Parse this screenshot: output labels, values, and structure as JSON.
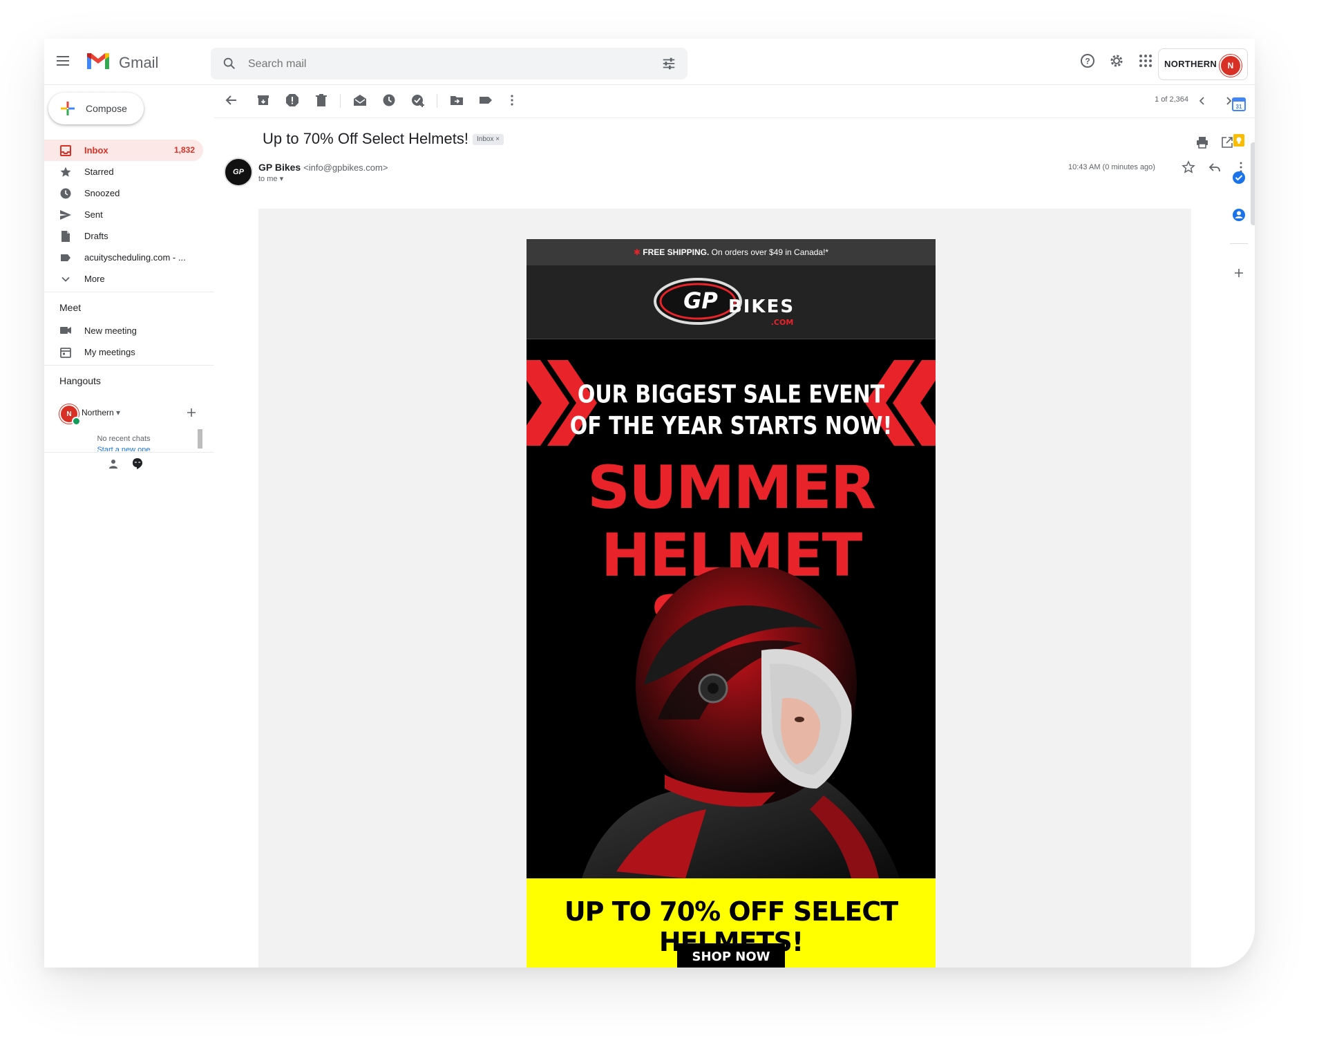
{
  "app": {
    "name": "Gmail"
  },
  "search": {
    "placeholder": "Search mail"
  },
  "account": {
    "brand": "NORTHERN",
    "avatar_letter": "N"
  },
  "compose": {
    "label": "Compose"
  },
  "nav": [
    {
      "label": "Inbox",
      "count": "1,832",
      "icon": "inbox-icon"
    },
    {
      "label": "Starred",
      "count": "",
      "icon": "star-icon"
    },
    {
      "label": "Snoozed",
      "count": "",
      "icon": "clock-icon"
    },
    {
      "label": "Sent",
      "count": "",
      "icon": "send-icon"
    },
    {
      "label": "Drafts",
      "count": "",
      "icon": "draft-icon"
    },
    {
      "label": "acuityscheduling.com - ...",
      "count": "",
      "icon": "label-icon"
    },
    {
      "label": "More",
      "count": "",
      "icon": "chevron-down-icon"
    }
  ],
  "meet": {
    "title": "Meet",
    "new_meeting": "New meeting",
    "my_meetings": "My meetings"
  },
  "hangouts": {
    "title": "Hangouts",
    "user": "Northern",
    "no_chats": "No recent chats",
    "start_chat": "Start a new one"
  },
  "toolbar": {
    "pager": "1 of 2,364"
  },
  "message": {
    "subject": "Up to 70% Off Select Helmets!",
    "badge": "Inbox ×",
    "sender_name": "GP Bikes",
    "sender_email": "<info@gpbikes.com>",
    "to": "to me ▾",
    "time": "10:43 AM (0 minutes ago)"
  },
  "email_body": {
    "shipping_bold": "FREE SHIPPING.",
    "shipping_rest": " On orders over $49 in Canada!*",
    "logo_text": "GP BIKES",
    "logo_sub": ".COM",
    "tagline_1": "OUR BIGGEST SALE EVENT",
    "tagline_2": "OF THE YEAR STARTS NOW!",
    "headline_1": "SUMMER",
    "headline_2": "HELMET SALE",
    "promo": "UP TO 70% OFF SELECT HELMETS!",
    "cta": "SHOP NOW"
  },
  "colors": {
    "gmail_red": "#d93025",
    "sale_red": "#e8232a",
    "promo_yellow": "#ffff00"
  }
}
